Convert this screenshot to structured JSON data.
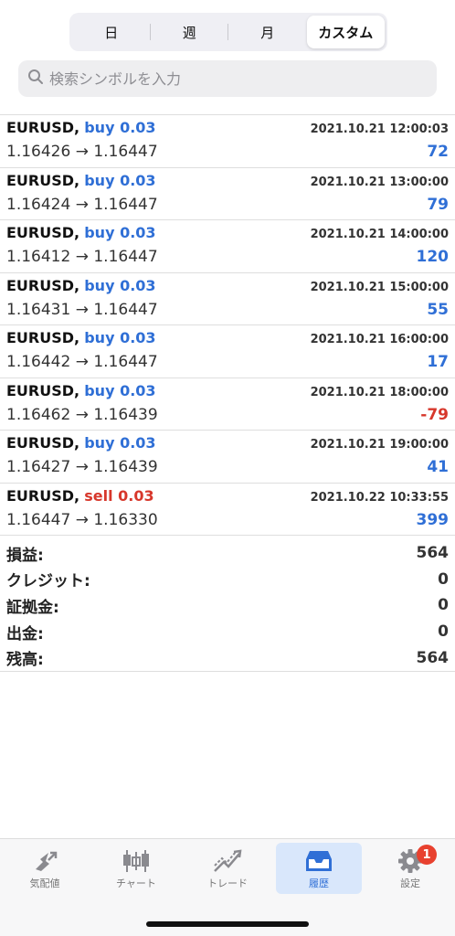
{
  "period_tabs": [
    {
      "label": "日",
      "active": false
    },
    {
      "label": "週",
      "active": false
    },
    {
      "label": "月",
      "active": false
    },
    {
      "label": "カスタム",
      "active": true
    }
  ],
  "search": {
    "placeholder": "検索シンボルを入力",
    "value": ""
  },
  "trades": [
    {
      "symbol": "EURUSD,",
      "side": "buy 0.03",
      "type": "buy",
      "time": "2021.10.21 12:00:03",
      "prices": "1.16426 → 1.16447",
      "profit": "72",
      "positive": true
    },
    {
      "symbol": "EURUSD,",
      "side": "buy 0.03",
      "type": "buy",
      "time": "2021.10.21 13:00:00",
      "prices": "1.16424 → 1.16447",
      "profit": "79",
      "positive": true
    },
    {
      "symbol": "EURUSD,",
      "side": "buy 0.03",
      "type": "buy",
      "time": "2021.10.21 14:00:00",
      "prices": "1.16412 → 1.16447",
      "profit": "120",
      "positive": true
    },
    {
      "symbol": "EURUSD,",
      "side": "buy 0.03",
      "type": "buy",
      "time": "2021.10.21 15:00:00",
      "prices": "1.16431 → 1.16447",
      "profit": "55",
      "positive": true
    },
    {
      "symbol": "EURUSD,",
      "side": "buy 0.03",
      "type": "buy",
      "time": "2021.10.21 16:00:00",
      "prices": "1.16442 → 1.16447",
      "profit": "17",
      "positive": true
    },
    {
      "symbol": "EURUSD,",
      "side": "buy 0.03",
      "type": "buy",
      "time": "2021.10.21 18:00:00",
      "prices": "1.16462 → 1.16439",
      "profit": "-79",
      "positive": false
    },
    {
      "symbol": "EURUSD,",
      "side": "buy 0.03",
      "type": "buy",
      "time": "2021.10.21 19:00:00",
      "prices": "1.16427 → 1.16439",
      "profit": "41",
      "positive": true
    },
    {
      "symbol": "EURUSD,",
      "side": "sell 0.03",
      "type": "sell",
      "time": "2021.10.22 10:33:55",
      "prices": "1.16447 → 1.16330",
      "profit": "399",
      "positive": true
    }
  ],
  "summary": [
    {
      "label": "損益:",
      "value": "564"
    },
    {
      "label": "クレジット:",
      "value": "0"
    },
    {
      "label": "証拠金:",
      "value": "0"
    },
    {
      "label": "出金:",
      "value": "0"
    },
    {
      "label": "残高:",
      "value": "564"
    }
  ],
  "tabbar": [
    {
      "label": "気配値",
      "icon": "quotes-icon",
      "active": false
    },
    {
      "label": "チャート",
      "icon": "chart-icon",
      "active": false
    },
    {
      "label": "トレード",
      "icon": "trade-icon",
      "active": false
    },
    {
      "label": "履歴",
      "icon": "history-icon",
      "active": true
    },
    {
      "label": "設定",
      "icon": "settings-icon",
      "active": false,
      "badge": "1"
    }
  ],
  "colors": {
    "accent": "#2f6fd6",
    "sell": "#d7372b",
    "badge": "#e8412f"
  }
}
